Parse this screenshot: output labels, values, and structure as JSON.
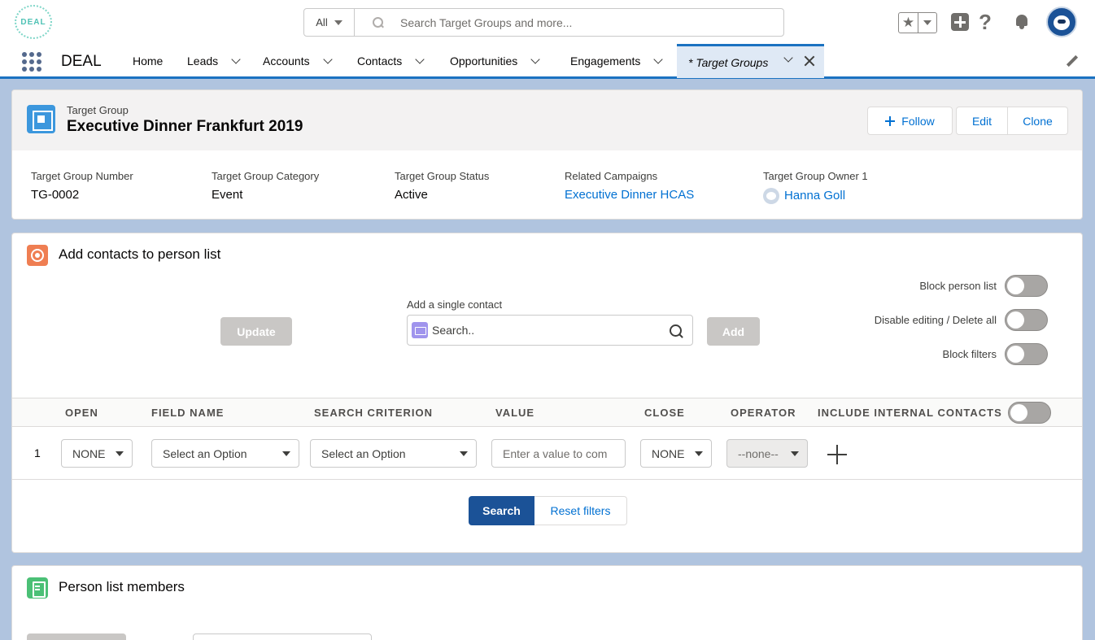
{
  "header": {
    "logo_text": "DEAL",
    "search_scope": "All",
    "search_placeholder": "Search Target Groups and more..."
  },
  "nav": {
    "app_name": "DEAL",
    "items": [
      {
        "label": "Home"
      },
      {
        "label": "Leads"
      },
      {
        "label": "Accounts"
      },
      {
        "label": "Contacts"
      },
      {
        "label": "Opportunities"
      },
      {
        "label": "Engagements"
      }
    ],
    "active_tab": "* Target Groups"
  },
  "record": {
    "type_label": "Target Group",
    "title": "Executive Dinner Frankfurt 2019",
    "buttons": {
      "follow": "Follow",
      "edit": "Edit",
      "clone": "Clone"
    },
    "fields": [
      {
        "label": "Target Group Number",
        "value": "TG-0002"
      },
      {
        "label": "Target Group Category",
        "value": "Event"
      },
      {
        "label": "Target Group Status",
        "value": "Active"
      },
      {
        "label": "Related Campaigns",
        "value": "Executive Dinner HCAS"
      },
      {
        "label": "Target Group Owner 1",
        "value": "Hanna Goll"
      }
    ]
  },
  "add_contacts": {
    "title": "Add contacts to person list",
    "update_label": "Update",
    "single_contact_label": "Add a single contact",
    "single_contact_placeholder": "Search..",
    "add_label": "Add",
    "toggles": {
      "block_person_list": "Block person list",
      "disable_editing": "Disable editing / Delete all",
      "block_filters": "Block filters"
    },
    "columns": {
      "open": "OPEN",
      "field_name": "FIELD NAME",
      "search_criterion": "SEARCH CRITERION",
      "value": "VALUE",
      "close": "CLOSE",
      "operator": "OPERATOR",
      "include_internal": "INCLUDE INTERNAL CONTACTS"
    },
    "row": {
      "number": "1",
      "open": "NONE",
      "field_name": "Select an Option",
      "search_criterion": "Select an Option",
      "value_placeholder": "Enter a value to com",
      "close": "NONE",
      "operator": "--none--"
    },
    "search_label": "Search",
    "reset_label": "Reset filters"
  },
  "members": {
    "title": "Person list members"
  }
}
